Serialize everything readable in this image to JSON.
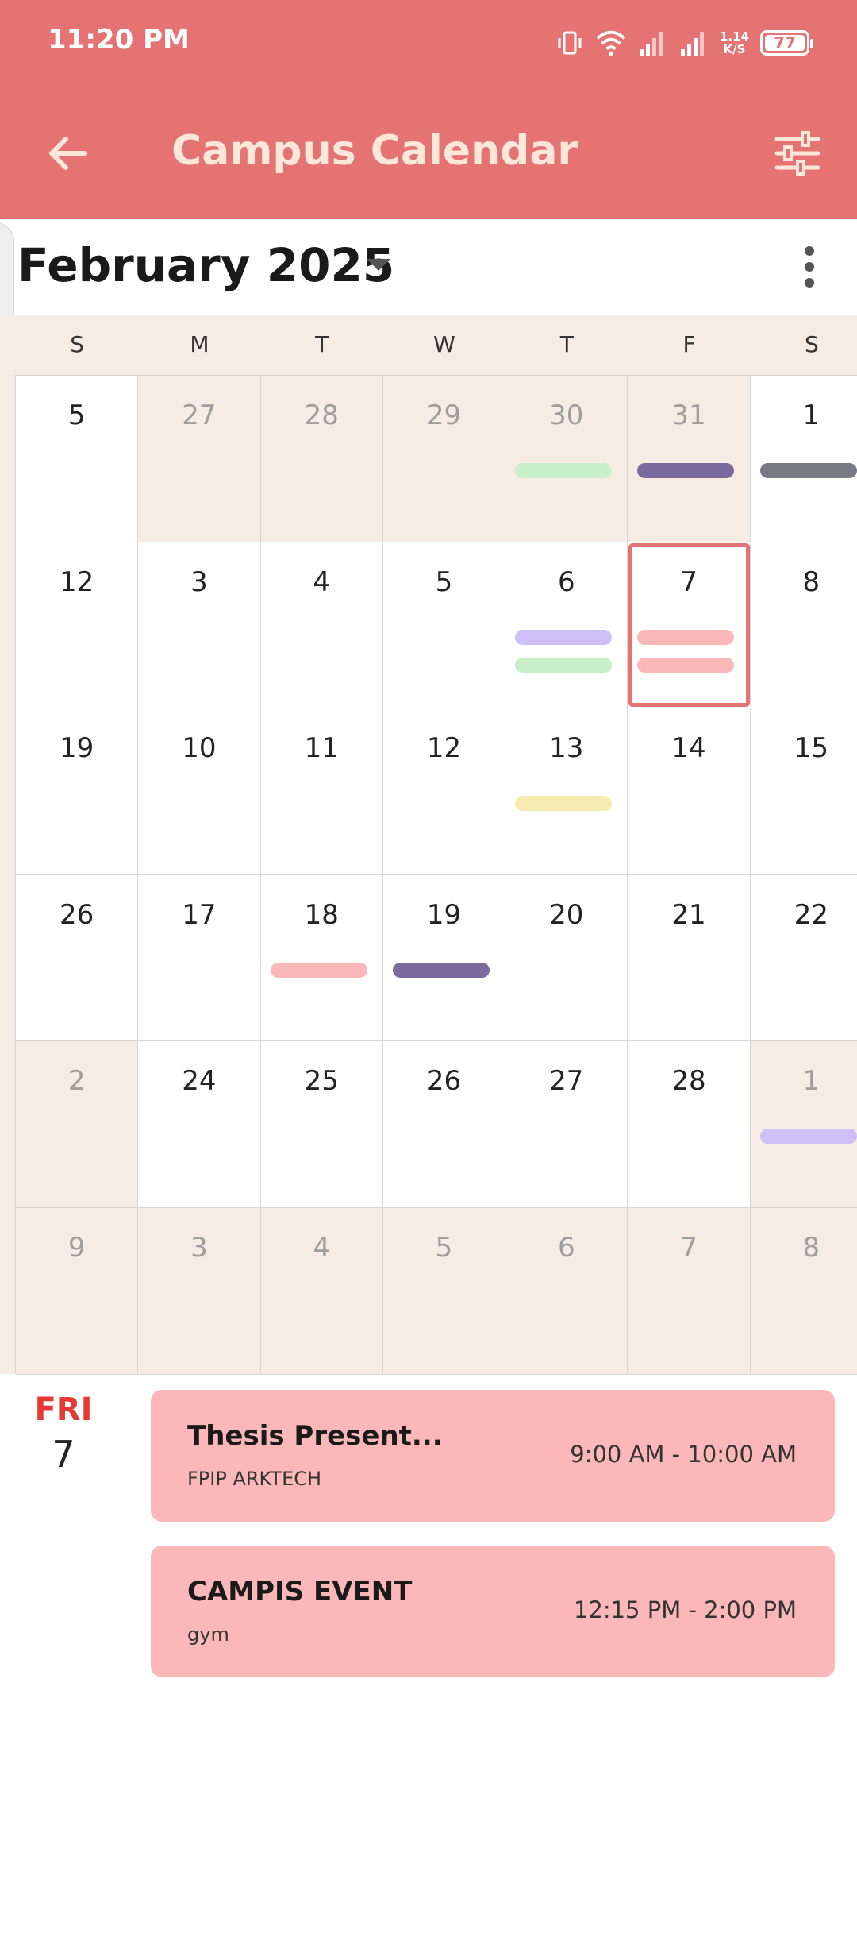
{
  "status_bar": {
    "time": "11:20 PM",
    "net_speed_top": "1.14",
    "net_speed_bottom": "K/S",
    "battery": "77"
  },
  "app_bar": {
    "title": "Campus Calendar",
    "back_icon": "arrow-left-icon",
    "filter_icon": "sliders-icon",
    "background": "#e57373",
    "title_color": "#fde8d8"
  },
  "calendar": {
    "month_label": "February 2025",
    "weekdays": [
      "S",
      "M",
      "T",
      "W",
      "T",
      "F",
      "S"
    ],
    "weeks": [
      [
        {
          "d": "5",
          "muted": false,
          "bars": []
        },
        {
          "d": "27",
          "muted": true,
          "bars": []
        },
        {
          "d": "28",
          "muted": true,
          "bars": []
        },
        {
          "d": "29",
          "muted": true,
          "bars": []
        },
        {
          "d": "30",
          "muted": true,
          "bars": [
            "#c8f0c8"
          ]
        },
        {
          "d": "31",
          "muted": true,
          "bars": [
            "#7b6a9e"
          ]
        },
        {
          "d": "1",
          "muted": false,
          "bars": [
            "#7a7a87"
          ]
        }
      ],
      [
        {
          "d": "12",
          "muted": false,
          "bars": []
        },
        {
          "d": "3",
          "muted": false,
          "bars": []
        },
        {
          "d": "4",
          "muted": false,
          "bars": []
        },
        {
          "d": "5",
          "muted": false,
          "bars": []
        },
        {
          "d": "6",
          "muted": false,
          "bars": [
            "#cdbff7",
            "#c8f0c8"
          ]
        },
        {
          "d": "7",
          "muted": false,
          "selected": true,
          "bars": [
            "#fcb8b8",
            "#fcb8b8"
          ]
        },
        {
          "d": "8",
          "muted": false,
          "bars": []
        }
      ],
      [
        {
          "d": "19",
          "muted": false,
          "bars": []
        },
        {
          "d": "10",
          "muted": false,
          "bars": []
        },
        {
          "d": "11",
          "muted": false,
          "bars": []
        },
        {
          "d": "12",
          "muted": false,
          "bars": []
        },
        {
          "d": "13",
          "muted": false,
          "bars": [
            "#f8ebb0"
          ]
        },
        {
          "d": "14",
          "muted": false,
          "bars": []
        },
        {
          "d": "15",
          "muted": false,
          "bars": []
        }
      ],
      [
        {
          "d": "26",
          "muted": false,
          "bars": []
        },
        {
          "d": "17",
          "muted": false,
          "bars": []
        },
        {
          "d": "18",
          "muted": false,
          "bars": [
            "#fcb8b8"
          ]
        },
        {
          "d": "19",
          "muted": false,
          "bars": [
            "#7b6a9e"
          ]
        },
        {
          "d": "20",
          "muted": false,
          "bars": []
        },
        {
          "d": "21",
          "muted": false,
          "bars": []
        },
        {
          "d": "22",
          "muted": false,
          "bars": []
        }
      ],
      [
        {
          "d": "2",
          "muted": true,
          "bars": []
        },
        {
          "d": "24",
          "muted": false,
          "bars": []
        },
        {
          "d": "25",
          "muted": false,
          "bars": []
        },
        {
          "d": "26",
          "muted": false,
          "bars": []
        },
        {
          "d": "27",
          "muted": false,
          "bars": []
        },
        {
          "d": "28",
          "muted": false,
          "bars": []
        },
        {
          "d": "1",
          "muted": true,
          "bars": [
            "#cdbff7"
          ]
        }
      ],
      [
        {
          "d": "9",
          "muted": true,
          "bars": []
        },
        {
          "d": "3",
          "muted": true,
          "bars": []
        },
        {
          "d": "4",
          "muted": true,
          "bars": []
        },
        {
          "d": "5",
          "muted": true,
          "bars": []
        },
        {
          "d": "6",
          "muted": true,
          "bars": []
        },
        {
          "d": "7",
          "muted": true,
          "bars": []
        },
        {
          "d": "8",
          "muted": true,
          "bars": []
        }
      ]
    ]
  },
  "agenda": {
    "dow": "FRI",
    "day": "7",
    "events": [
      {
        "title": "Thesis Present...",
        "location": "FPIP ARKTECH",
        "time": "9:00 AM - 10:00 AM"
      },
      {
        "title": "CAMPIS EVENT",
        "location": "gym",
        "time": "12:15 PM - 2:00 PM"
      }
    ]
  }
}
